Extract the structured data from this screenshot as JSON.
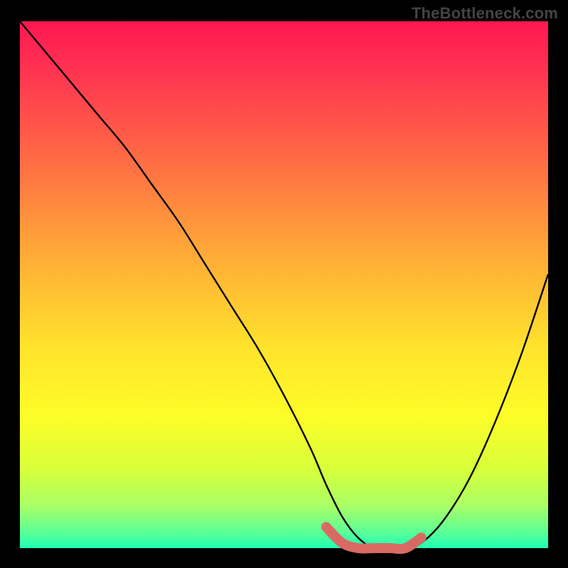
{
  "watermark": "TheBottleneck.com",
  "colors": {
    "curve": "#000000",
    "marker": "#d86a63",
    "background": "#000000",
    "gradient_top": "#ff1751",
    "gradient_bottom": "#1effb4"
  },
  "chart_data": {
    "type": "line",
    "title": "",
    "xlabel": "",
    "ylabel": "",
    "xlim": [
      0,
      100
    ],
    "ylim": [
      0,
      100
    ],
    "series": [
      {
        "name": "bottleneck-curve",
        "x": [
          0,
          5,
          10,
          15,
          20,
          25,
          30,
          35,
          40,
          45,
          50,
          55,
          58,
          61,
          64,
          67,
          70,
          73,
          76,
          80,
          85,
          90,
          95,
          100
        ],
        "y": [
          100,
          94,
          88,
          82,
          76,
          69,
          62,
          54,
          46,
          38,
          29,
          19,
          12,
          6,
          2,
          0,
          0,
          0,
          1,
          5,
          13,
          24,
          37,
          52
        ]
      }
    ],
    "highlight_region": {
      "name": "optimal-range",
      "x": [
        58,
        61,
        64,
        67,
        70,
        73,
        76
      ],
      "y": [
        4,
        1,
        0,
        0,
        0,
        0,
        2
      ]
    }
  }
}
